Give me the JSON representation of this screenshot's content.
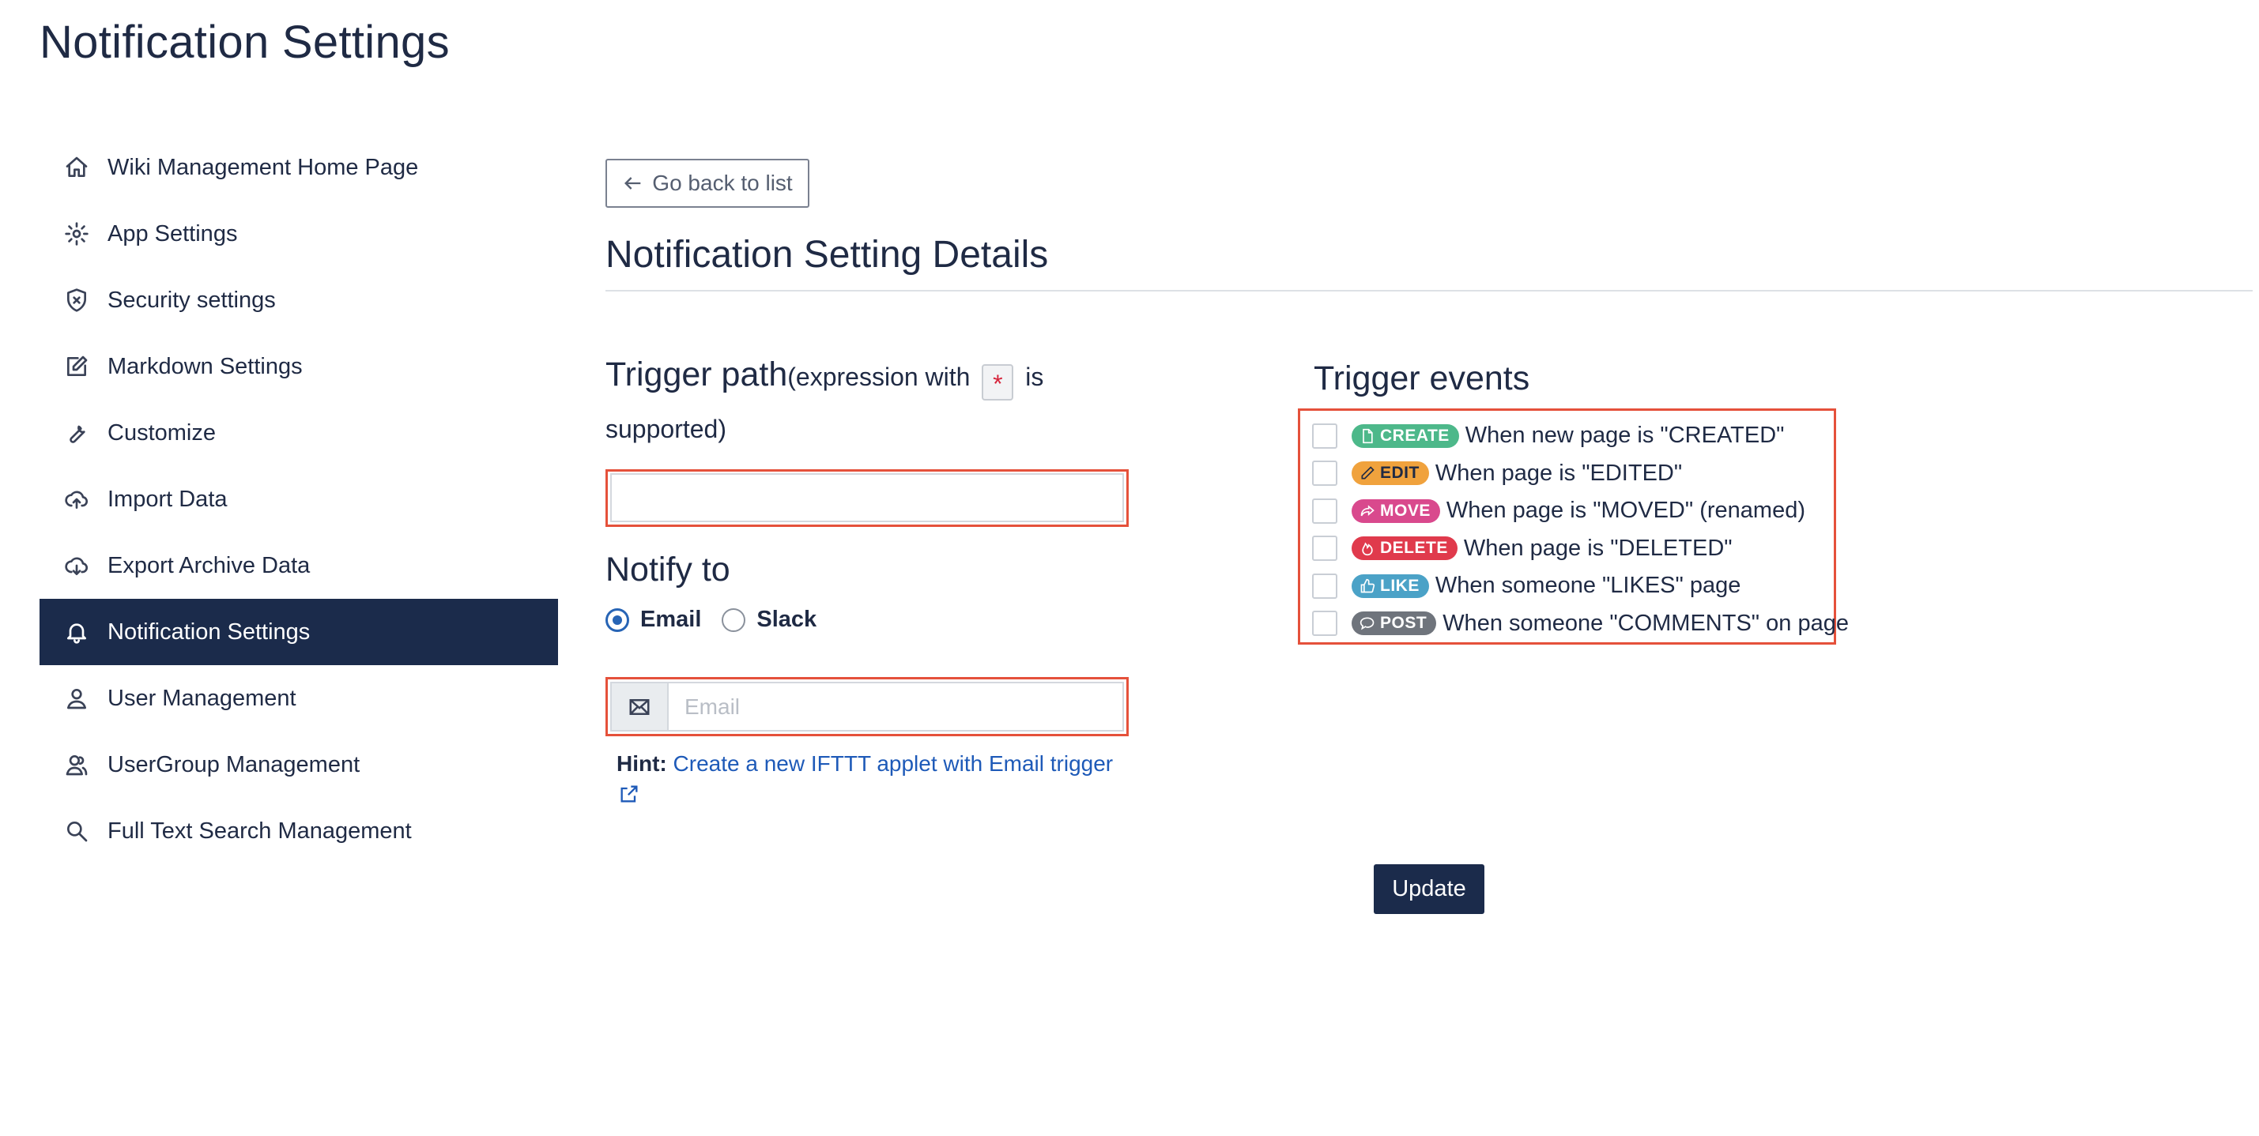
{
  "page": {
    "title": "Notification Settings"
  },
  "sidebar": {
    "items": [
      {
        "label": "Wiki Management Home Page",
        "icon": "home-icon"
      },
      {
        "label": "App Settings",
        "icon": "gear-icon"
      },
      {
        "label": "Security settings",
        "icon": "shield-icon"
      },
      {
        "label": "Markdown Settings",
        "icon": "edit-icon"
      },
      {
        "label": "Customize",
        "icon": "wrench-icon"
      },
      {
        "label": "Import Data",
        "icon": "cloud-upload-icon"
      },
      {
        "label": "Export Archive Data",
        "icon": "cloud-download-icon"
      },
      {
        "label": "Notification Settings",
        "icon": "bell-icon",
        "active": true
      },
      {
        "label": "User Management",
        "icon": "user-icon"
      },
      {
        "label": "UserGroup Management",
        "icon": "users-icon"
      },
      {
        "label": "Full Text Search Management",
        "icon": "search-icon"
      }
    ]
  },
  "main": {
    "back_button": "Go back to list",
    "section_title": "Notification Setting Details",
    "trigger_path": {
      "label": "Trigger path",
      "note_before": "(expression with ",
      "star": "*",
      "note_after": " is",
      "note_line2": "supported)",
      "value": ""
    },
    "notify_to": {
      "label": "Notify to",
      "options": [
        "Email",
        "Slack"
      ],
      "selected": "Email"
    },
    "email": {
      "placeholder": "Email",
      "value": ""
    },
    "hint": {
      "label": "Hint:",
      "link_text": "Create a new IFTTT applet with Email trigger"
    },
    "trigger_events": {
      "title": "Trigger events",
      "events": [
        {
          "badge": "CREATE",
          "text": "When new page is \"CREATED\"",
          "color": "#4db88a",
          "icon": "file-icon",
          "checked": false
        },
        {
          "badge": "EDIT",
          "text": "When page is \"EDITED\"",
          "color": "#f0a23d",
          "icon": "pencil-icon",
          "checked": false
        },
        {
          "badge": "MOVE",
          "text": "When page is \"MOVED\" (renamed)",
          "color": "#d9498d",
          "icon": "share-icon",
          "checked": false
        },
        {
          "badge": "DELETE",
          "text": "When page is \"DELETED\"",
          "color": "#e03a4c",
          "icon": "fire-icon",
          "checked": false
        },
        {
          "badge": "LIKE",
          "text": "When someone \"LIKES\" page",
          "color": "#4ba2c7",
          "icon": "thumbs-up-icon",
          "checked": false
        },
        {
          "badge": "POST",
          "text": "When someone \"COMMENTS\" on page",
          "color": "#6f747c",
          "icon": "comment-icon",
          "checked": false
        }
      ]
    },
    "update_button": "Update",
    "highlight_color": "#e5513b",
    "accent_color": "#1b2b4b"
  }
}
